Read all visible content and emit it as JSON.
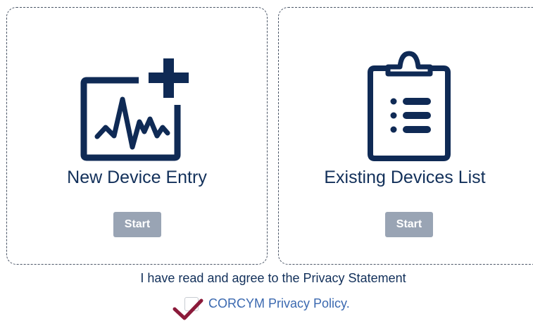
{
  "cards": [
    {
      "title": "New Device Entry",
      "icon": "monitor-waveform-plus-icon",
      "button_label": "Start"
    },
    {
      "title": "Existing Devices List",
      "icon": "clipboard-list-icon",
      "button_label": "Start"
    }
  ],
  "agreement": {
    "text": "I have read and agree to the Privacy Statement",
    "checked": true,
    "link_text": "CORCYM Privacy Policy."
  },
  "colors": {
    "icon_navy": "#0f2a55",
    "title_navy": "#12305a",
    "button_gray": "#99a4b4",
    "link_blue": "#3b69b0",
    "checkmark_maroon": "#8b1a3a"
  }
}
